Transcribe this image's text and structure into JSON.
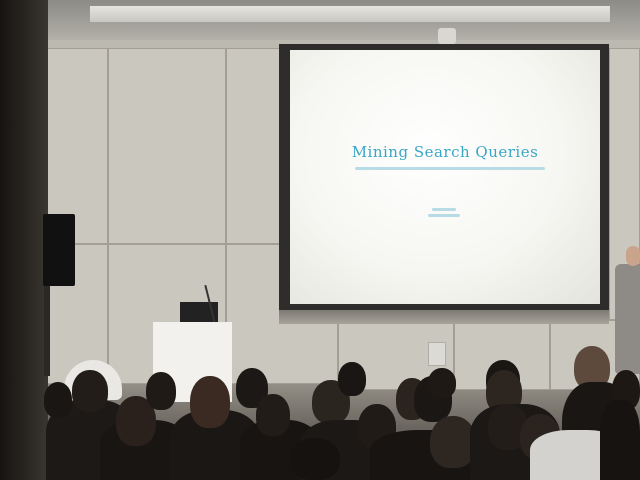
{
  "scene": {
    "description_tag": "lecture-hall",
    "colors": {
      "wall": "#cac7bf",
      "screen": "#f6f6f2",
      "slide_text": "#3aa6c4",
      "audience": "#1e1a17"
    }
  },
  "slide": {
    "title": "Mining Search Queries"
  }
}
